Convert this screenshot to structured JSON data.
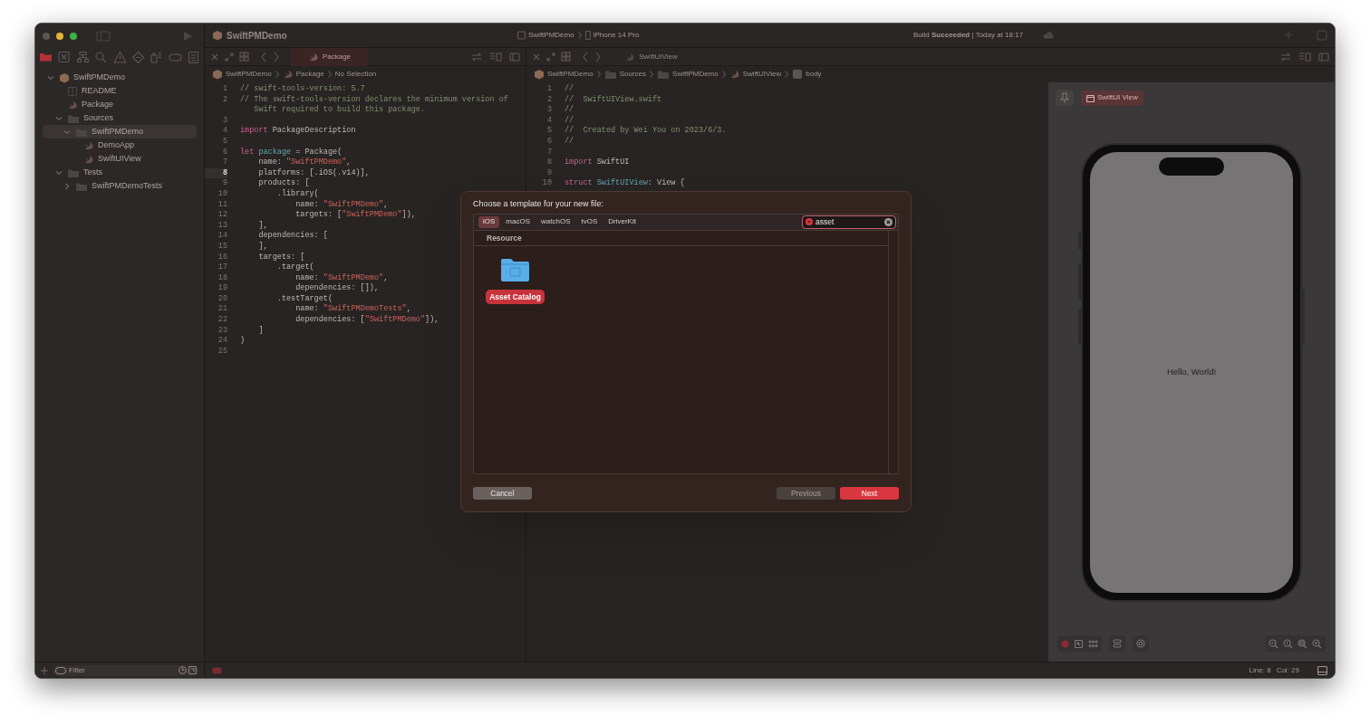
{
  "window": {
    "title": "SwiftPMDemo",
    "scheme": [
      "SwiftPMDemo",
      "iPhone 14 Pro"
    ],
    "activity": "Build **Succeeded** | Today at 18:17"
  },
  "navigator": {
    "tabs": [
      {
        "selected": true
      },
      {
        "selected": false
      },
      {
        "selected": false
      },
      {
        "selected": false
      },
      {
        "selected": false
      },
      {
        "selected": false
      },
      {
        "selected": false
      },
      {
        "selected": false
      },
      {
        "selected": false
      }
    ],
    "items": [
      {
        "label": "SwiftPMDemo",
        "kind": "package",
        "expanded": true,
        "selected": false,
        "children": [
          {
            "label": "README",
            "kind": "document",
            "selected": false
          },
          {
            "label": "Package",
            "kind": "swift",
            "selected": false
          },
          {
            "label": "Sources",
            "kind": "folder",
            "expanded": true,
            "selected": false,
            "children": [
              {
                "label": "SwiftPMDemo",
                "kind": "folder",
                "expanded": true,
                "selected": true,
                "children": [
                  {
                    "label": "DemoApp",
                    "kind": "swift",
                    "selected": false
                  },
                  {
                    "label": "SwiftUIView",
                    "kind": "swift",
                    "selected": false
                  }
                ]
              }
            ]
          },
          {
            "label": "Tests",
            "kind": "folder",
            "expanded": true,
            "selected": false,
            "children": [
              {
                "label": "SwiftPMDemoTests",
                "kind": "folder",
                "expanded": false,
                "selected": false
              }
            ]
          }
        ]
      }
    ],
    "filter": {
      "placeholder": "Filter"
    }
  },
  "editors": [
    {
      "tabs": [
        {
          "label": "Package",
          "selected": true
        }
      ],
      "breadcrumb": [
        {
          "label": "SwiftPMDemo",
          "kind": "package"
        },
        {
          "label": "Package",
          "kind": "swift"
        },
        {
          "label": "No Selection",
          "kind": "text"
        }
      ],
      "lines": [
        {
          "number": "1",
          "current": false,
          "tokens": [
            {
              "kind": "comment",
              "text": "// swift-tools-version: 5.7"
            }
          ]
        },
        {
          "number": "2",
          "current": false,
          "tokens": [
            {
              "kind": "comment",
              "text": "// The swift-tools-version declares the minimum version of"
            }
          ]
        },
        {
          "tokens": [
            {
              "kind": "comment",
              "text": "   Swift required to build this package."
            }
          ]
        },
        {
          "number": "3",
          "current": false
        },
        {
          "number": "4",
          "current": false,
          "tokens": [
            {
              "kind": "keyword",
              "text": "import"
            },
            {
              "kind": "plain",
              "text": " PackageDescription"
            }
          ]
        },
        {
          "number": "5",
          "current": false
        },
        {
          "number": "6",
          "current": false,
          "tokens": [
            {
              "kind": "keyword",
              "text": "let "
            },
            {
              "kind": "declaration",
              "text": "package"
            },
            {
              "kind": "plain",
              "text": " = Package("
            }
          ]
        },
        {
          "number": "7",
          "current": false,
          "tokens": [
            {
              "kind": "plain",
              "text": "    name: "
            },
            {
              "kind": "string",
              "text": "\"SwiftPMDemo\""
            },
            {
              "kind": "plain",
              "text": ","
            }
          ]
        },
        {
          "number": "8",
          "current": true,
          "tokens": [
            {
              "kind": "plain",
              "text": "    platforms: [.iOS(.v14)],"
            }
          ]
        },
        {
          "number": "9",
          "current": false,
          "tokens": [
            {
              "kind": "plain",
              "text": "    products: ["
            }
          ]
        },
        {
          "number": "10",
          "current": false,
          "tokens": [
            {
              "kind": "plain",
              "text": "        .library("
            }
          ]
        },
        {
          "number": "11",
          "current": false,
          "tokens": [
            {
              "kind": "plain",
              "text": "            name: "
            },
            {
              "kind": "string",
              "text": "\"SwiftPMDemo\""
            },
            {
              "kind": "plain",
              "text": ","
            }
          ]
        },
        {
          "number": "12",
          "current": false,
          "tokens": [
            {
              "kind": "plain",
              "text": "            targets: ["
            },
            {
              "kind": "string",
              "text": "\"SwiftPMDemo\""
            },
            {
              "kind": "plain",
              "text": "]),"
            }
          ]
        },
        {
          "number": "13",
          "current": false,
          "tokens": [
            {
              "kind": "plain",
              "text": "    ],"
            }
          ]
        },
        {
          "number": "14",
          "current": false,
          "tokens": [
            {
              "kind": "plain",
              "text": "    dependencies: ["
            }
          ]
        },
        {
          "number": "15",
          "current": false,
          "tokens": [
            {
              "kind": "plain",
              "text": "    ],"
            }
          ]
        },
        {
          "number": "16",
          "current": false,
          "tokens": [
            {
              "kind": "plain",
              "text": "    targets: ["
            }
          ]
        },
        {
          "number": "17",
          "current": false,
          "tokens": [
            {
              "kind": "plain",
              "text": "        .target("
            }
          ]
        },
        {
          "number": "18",
          "current": false,
          "tokens": [
            {
              "kind": "plain",
              "text": "            name: "
            },
            {
              "kind": "string",
              "text": "\"SwiftPMDemo\""
            },
            {
              "kind": "plain",
              "text": ","
            }
          ]
        },
        {
          "number": "19",
          "current": false,
          "tokens": [
            {
              "kind": "plain",
              "text": "            dependencies: []),"
            }
          ]
        },
        {
          "number": "20",
          "current": false,
          "tokens": [
            {
              "kind": "plain",
              "text": "        .testTarget("
            }
          ]
        },
        {
          "number": "21",
          "current": false,
          "tokens": [
            {
              "kind": "plain",
              "text": "            name: "
            },
            {
              "kind": "string",
              "text": "\"SwiftPMDemoTests\""
            },
            {
              "kind": "plain",
              "text": ","
            }
          ]
        },
        {
          "number": "22",
          "current": false,
          "tokens": [
            {
              "kind": "plain",
              "text": "            dependencies: ["
            },
            {
              "kind": "string",
              "text": "\"SwiftPMDemo\""
            },
            {
              "kind": "plain",
              "text": "]),"
            }
          ]
        },
        {
          "number": "23",
          "current": false,
          "tokens": [
            {
              "kind": "plain",
              "text": "    ]"
            }
          ]
        },
        {
          "number": "24",
          "current": false,
          "tokens": [
            {
              "kind": "plain",
              "text": ")"
            }
          ]
        },
        {
          "number": "25",
          "current": false
        }
      ]
    },
    {
      "tabs": [
        {
          "label": "SwiftUIView",
          "selected": false
        }
      ],
      "breadcrumb": [
        {
          "label": "SwiftPMDemo",
          "kind": "package"
        },
        {
          "label": "Sources",
          "kind": "folder"
        },
        {
          "label": "SwiftPMDemo",
          "kind": "folder"
        },
        {
          "label": "SwiftUIView",
          "kind": "swift"
        },
        {
          "label": "body",
          "kind": "property"
        }
      ],
      "lines": [
        {
          "number": "1",
          "current": false,
          "tokens": [
            {
              "kind": "comment",
              "text": "//"
            }
          ]
        },
        {
          "number": "2",
          "current": false,
          "tokens": [
            {
              "kind": "comment",
              "text": "//  SwiftUIView.swift"
            }
          ]
        },
        {
          "number": "3",
          "current": false,
          "tokens": [
            {
              "kind": "comment",
              "text": "//"
            }
          ]
        },
        {
          "number": "4",
          "current": false,
          "tokens": [
            {
              "kind": "comment",
              "text": "//"
            }
          ]
        },
        {
          "number": "5",
          "current": false,
          "tokens": [
            {
              "kind": "comment",
              "text": "//  Created by Wei You on 2023/6/3."
            }
          ]
        },
        {
          "number": "6",
          "current": false,
          "tokens": [
            {
              "kind": "comment",
              "text": "//"
            }
          ]
        },
        {
          "number": "7",
          "current": false
        },
        {
          "number": "8",
          "current": false,
          "tokens": [
            {
              "kind": "keyword",
              "text": "import"
            },
            {
              "kind": "plain",
              "text": " SwiftUI"
            }
          ]
        },
        {
          "number": "9",
          "current": false
        },
        {
          "number": "10",
          "current": false,
          "tokens": [
            {
              "kind": "keyword",
              "text": "struct "
            },
            {
              "kind": "declaration",
              "text": "SwiftUIView"
            },
            {
              "kind": "plain",
              "text": ": View {"
            }
          ]
        }
      ]
    }
  ],
  "preview": {
    "chip": "SwiftUI View",
    "content": "Hello, World!"
  },
  "status_bar": {
    "line": "Line: 8",
    "column": "Col: 29"
  },
  "dialog": {
    "title": "Choose a template for your new file:",
    "platforms": [
      {
        "label": "iOS",
        "selected": true
      },
      {
        "label": "macOS",
        "selected": false
      },
      {
        "label": "watchOS",
        "selected": false
      },
      {
        "label": "tvOS",
        "selected": false
      },
      {
        "label": "DriverKit",
        "selected": false
      }
    ],
    "search": {
      "value": "asset"
    },
    "sections": [
      {
        "title": "Resource",
        "templates": [
          {
            "label": "Asset Catalog",
            "selected": true
          }
        ]
      }
    ],
    "buttons": [
      {
        "label": "Cancel",
        "kind": "cancel",
        "disabled": false
      },
      {
        "label": "Previous",
        "kind": "secondary",
        "disabled": true
      },
      {
        "label": "Next",
        "kind": "default",
        "disabled": false
      }
    ]
  }
}
